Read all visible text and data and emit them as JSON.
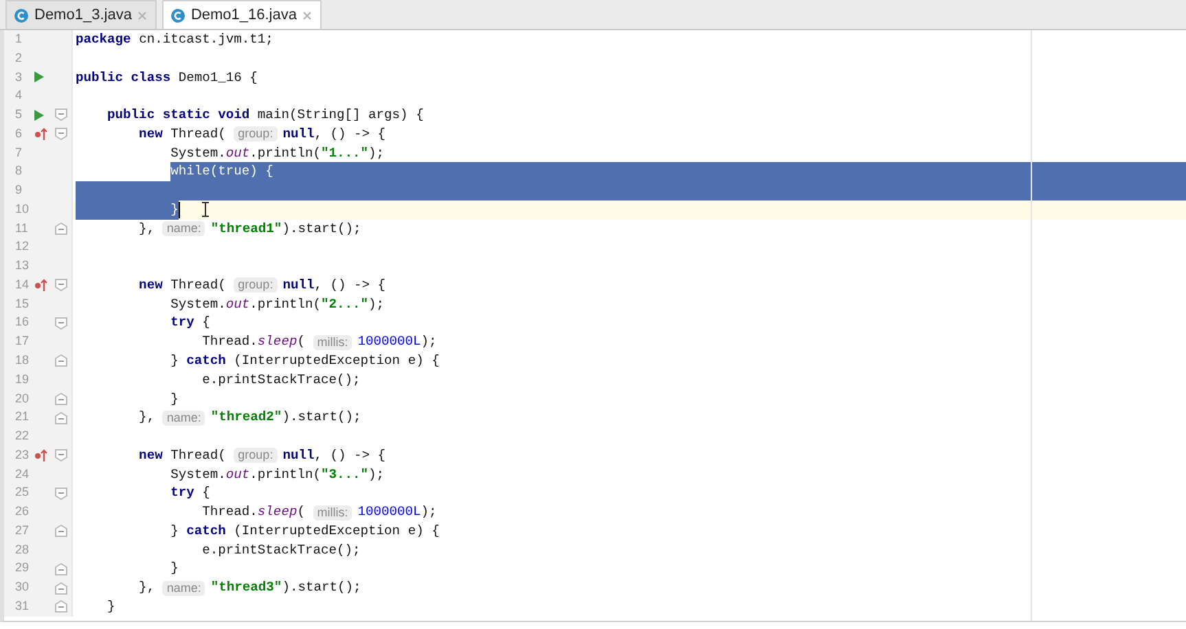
{
  "tabs": [
    {
      "label": "Demo1_3.java",
      "selected": false
    },
    {
      "label": "Demo1_16.java",
      "selected": true
    }
  ],
  "editor": {
    "lines": [
      {
        "number": "1",
        "tokens": [
          {
            "kind": "kw",
            "text": "package"
          },
          {
            "kind": "plain",
            "text": " cn.itcast.jvm.t1;"
          }
        ]
      },
      {
        "number": "2"
      },
      {
        "number": "3",
        "runnable": true,
        "tokens": [
          {
            "kind": "kw",
            "text": "public class"
          },
          {
            "kind": "plain",
            "text": " Demo1_16 {"
          }
        ]
      },
      {
        "number": "4"
      },
      {
        "number": "5",
        "runnable": true,
        "fold_open": true,
        "tokens": [
          {
            "kind": "kw",
            "text": "    public static void"
          },
          {
            "kind": "plain",
            "text": " main(String[] args) {"
          }
        ]
      },
      {
        "number": "6",
        "overrides": true,
        "fold_open": true,
        "tokens": [
          {
            "kind": "kw",
            "text": "        new"
          },
          {
            "kind": "plain",
            "text": " Thread( "
          },
          {
            "kind": "hint",
            "text": "group:"
          },
          {
            "kind": "kw",
            "text": "null"
          },
          {
            "kind": "plain",
            "text": ", () -> {"
          }
        ]
      },
      {
        "number": "7",
        "tokens": [
          {
            "kind": "plain",
            "text": "            System."
          },
          {
            "kind": "ital",
            "text": "out"
          },
          {
            "kind": "plain",
            "text": ".println("
          },
          {
            "kind": "str",
            "text": "\"1...\""
          },
          {
            "kind": "plain",
            "text": ");"
          }
        ]
      },
      {
        "number": "8",
        "selected": true,
        "tokens": [
          {
            "kind": "plain",
            "text": "            while(true) {"
          }
        ]
      },
      {
        "number": "9",
        "selected": true
      },
      {
        "number": "10",
        "selected": true,
        "current": true,
        "mouse_cursor": true,
        "tokens": [
          {
            "kind": "plain",
            "text": "            }"
          }
        ]
      },
      {
        "number": "11",
        "fold_close": true,
        "tokens": [
          {
            "kind": "plain",
            "text": "        }, "
          },
          {
            "kind": "hint",
            "text": "name:"
          },
          {
            "kind": "str",
            "text": "\"thread1\""
          },
          {
            "kind": "plain",
            "text": ").start();"
          }
        ]
      },
      {
        "number": "12"
      },
      {
        "number": "13"
      },
      {
        "number": "14",
        "overrides": true,
        "fold_open": true,
        "tokens": [
          {
            "kind": "kw",
            "text": "        new"
          },
          {
            "kind": "plain",
            "text": " Thread( "
          },
          {
            "kind": "hint",
            "text": "group:"
          },
          {
            "kind": "kw",
            "text": "null"
          },
          {
            "kind": "plain",
            "text": ", () -> {"
          }
        ]
      },
      {
        "number": "15",
        "tokens": [
          {
            "kind": "plain",
            "text": "            System."
          },
          {
            "kind": "ital",
            "text": "out"
          },
          {
            "kind": "plain",
            "text": ".println("
          },
          {
            "kind": "str",
            "text": "\"2...\""
          },
          {
            "kind": "plain",
            "text": ");"
          }
        ]
      },
      {
        "number": "16",
        "fold_open": true,
        "tokens": [
          {
            "kind": "kw",
            "text": "            try"
          },
          {
            "kind": "plain",
            "text": " {"
          }
        ]
      },
      {
        "number": "17",
        "tokens": [
          {
            "kind": "plain",
            "text": "                Thread."
          },
          {
            "kind": "ital",
            "text": "sleep"
          },
          {
            "kind": "plain",
            "text": "( "
          },
          {
            "kind": "hint",
            "text": "millis:"
          },
          {
            "kind": "num",
            "text": "1000000L"
          },
          {
            "kind": "plain",
            "text": ");"
          }
        ]
      },
      {
        "number": "18",
        "fold_close": true,
        "tokens": [
          {
            "kind": "plain",
            "text": "            } "
          },
          {
            "kind": "kw",
            "text": "catch"
          },
          {
            "kind": "plain",
            "text": " (InterruptedException e) {"
          }
        ]
      },
      {
        "number": "19",
        "tokens": [
          {
            "kind": "plain",
            "text": "                e.printStackTrace();"
          }
        ]
      },
      {
        "number": "20",
        "fold_close": true,
        "tokens": [
          {
            "kind": "plain",
            "text": "            }"
          }
        ]
      },
      {
        "number": "21",
        "fold_close": true,
        "tokens": [
          {
            "kind": "plain",
            "text": "        }, "
          },
          {
            "kind": "hint",
            "text": "name:"
          },
          {
            "kind": "str",
            "text": "\"thread2\""
          },
          {
            "kind": "plain",
            "text": ").start();"
          }
        ]
      },
      {
        "number": "22"
      },
      {
        "number": "23",
        "overrides": true,
        "fold_open": true,
        "tokens": [
          {
            "kind": "kw",
            "text": "        new"
          },
          {
            "kind": "plain",
            "text": " Thread( "
          },
          {
            "kind": "hint",
            "text": "group:"
          },
          {
            "kind": "kw",
            "text": "null"
          },
          {
            "kind": "plain",
            "text": ", () -> {"
          }
        ]
      },
      {
        "number": "24",
        "tokens": [
          {
            "kind": "plain",
            "text": "            System."
          },
          {
            "kind": "ital",
            "text": "out"
          },
          {
            "kind": "plain",
            "text": ".println("
          },
          {
            "kind": "str",
            "text": "\"3...\""
          },
          {
            "kind": "plain",
            "text": ");"
          }
        ]
      },
      {
        "number": "25",
        "fold_open": true,
        "tokens": [
          {
            "kind": "kw",
            "text": "            try"
          },
          {
            "kind": "plain",
            "text": " {"
          }
        ]
      },
      {
        "number": "26",
        "tokens": [
          {
            "kind": "plain",
            "text": "                Thread."
          },
          {
            "kind": "ital",
            "text": "sleep"
          },
          {
            "kind": "plain",
            "text": "( "
          },
          {
            "kind": "hint",
            "text": "millis:"
          },
          {
            "kind": "num",
            "text": "1000000L"
          },
          {
            "kind": "plain",
            "text": ");"
          }
        ]
      },
      {
        "number": "27",
        "fold_close": true,
        "tokens": [
          {
            "kind": "plain",
            "text": "            } "
          },
          {
            "kind": "kw",
            "text": "catch"
          },
          {
            "kind": "plain",
            "text": " (InterruptedException e) {"
          }
        ]
      },
      {
        "number": "28",
        "tokens": [
          {
            "kind": "plain",
            "text": "                e.printStackTrace();"
          }
        ]
      },
      {
        "number": "29",
        "fold_close": true,
        "tokens": [
          {
            "kind": "plain",
            "text": "            }"
          }
        ]
      },
      {
        "number": "30",
        "fold_close": true,
        "tokens": [
          {
            "kind": "plain",
            "text": "        }, "
          },
          {
            "kind": "hint",
            "text": "name:"
          },
          {
            "kind": "str",
            "text": "\"thread3\""
          },
          {
            "kind": "plain",
            "text": ").start();"
          }
        ]
      },
      {
        "number": "31",
        "fold_close": true,
        "tokens": [
          {
            "kind": "plain",
            "text": "    }"
          }
        ]
      }
    ]
  }
}
